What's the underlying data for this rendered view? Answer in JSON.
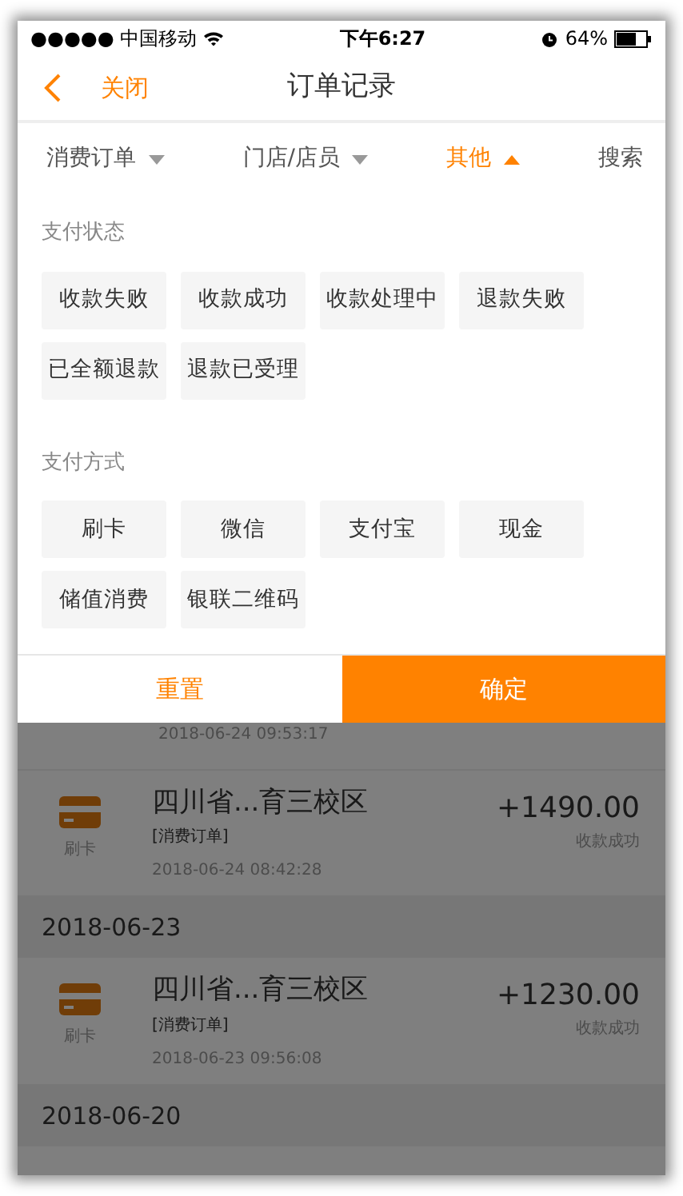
{
  "status_bar": {
    "carrier": "●●●●● 中国移动",
    "time": "下午6:27",
    "battery": "64%"
  },
  "nav": {
    "back_label": "关闭",
    "title": "订单记录"
  },
  "filters": [
    {
      "label": "消费订单",
      "selected": false,
      "kind": "dropdown"
    },
    {
      "label": "门店/店员",
      "selected": false,
      "kind": "dropdown"
    },
    {
      "label": "其他",
      "selected": true,
      "kind": "dropdown"
    },
    {
      "label": "搜索",
      "selected": false,
      "kind": "plain"
    }
  ],
  "sections": [
    {
      "title": "支付状态",
      "options": [
        {
          "label": "收款失败",
          "selected": false
        },
        {
          "label": "收款成功",
          "selected": false
        },
        {
          "label": "收款处理中",
          "selected": false
        },
        {
          "label": "退款失败",
          "selected": false
        },
        {
          "label": "已全额退款",
          "selected": false
        },
        {
          "label": "退款已受理",
          "selected": false
        }
      ]
    },
    {
      "title": "支付方式",
      "options": [
        {
          "label": "刷卡",
          "selected": false
        },
        {
          "label": "微信",
          "selected": false
        },
        {
          "label": "支付宝",
          "selected": false
        },
        {
          "label": "现金",
          "selected": false
        },
        {
          "label": "储值消费",
          "selected": false
        },
        {
          "label": "银联二维码",
          "selected": false
        }
      ]
    }
  ],
  "buttons": {
    "reset": "重置",
    "confirm": "确定"
  },
  "list": [
    {
      "kind": "partial",
      "time": "2018-06-24 09:53:17"
    },
    {
      "kind": "order",
      "method": "刷卡",
      "title": "四川省...育三校区",
      "tag": "[消费订单]",
      "time": "2018-06-24 08:42:28",
      "amount": "+1490.00",
      "status": "收款成功"
    },
    {
      "kind": "date",
      "label": "2018-06-23"
    },
    {
      "kind": "order",
      "method": "刷卡",
      "title": "四川省...育三校区",
      "tag": "[消费订单]",
      "time": "2018-06-23 09:56:08",
      "amount": "+1230.00",
      "status": "收款成功"
    },
    {
      "kind": "date",
      "label": "2018-06-20"
    }
  ]
}
